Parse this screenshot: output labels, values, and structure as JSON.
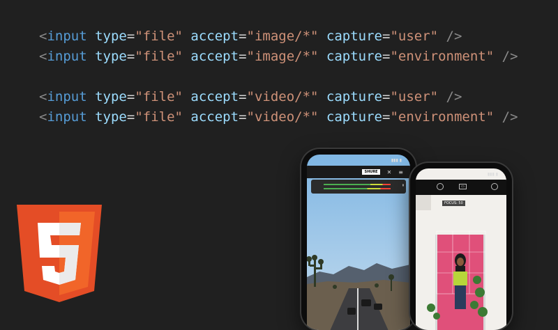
{
  "code_lines": [
    {
      "tag": "input",
      "type_attr": "type",
      "type_val": "\"file\"",
      "accept_attr": "accept",
      "accept_val": "\"image/*\"",
      "capture_attr": "capture",
      "capture_val": "\"user\""
    },
    {
      "tag": "input",
      "type_attr": "type",
      "type_val": "\"file\"",
      "accept_attr": "accept",
      "accept_val": "\"image/*\"",
      "capture_attr": "capture",
      "capture_val": "\"environment\""
    },
    {
      "tag": "input",
      "type_attr": "type",
      "type_val": "\"file\"",
      "accept_attr": "accept",
      "accept_val": "\"video/*\"",
      "capture_attr": "capture",
      "capture_val": "\"user\""
    },
    {
      "tag": "input",
      "type_attr": "type",
      "type_val": "\"file\"",
      "accept_attr": "accept",
      "accept_val": "\"video/*\"",
      "capture_attr": "capture",
      "capture_val": "\"environment\""
    }
  ],
  "logo": {
    "numeral": "5",
    "colors": {
      "dark": "#e44d26",
      "light": "#f16529"
    }
  },
  "phone_left": {
    "brand_label": "SHURE",
    "focus_label": ""
  },
  "phone_right": {
    "focus_label": "FOCUS: 50"
  }
}
